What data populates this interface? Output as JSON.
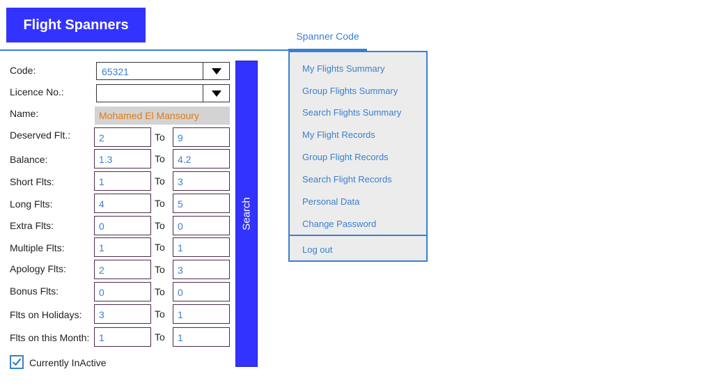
{
  "app": {
    "title": "Flight Spanners"
  },
  "menu": {
    "tab_label": "Spanner Code",
    "items": [
      "My Flights Summary",
      "Group Flights Summary",
      "Search Flights Summary",
      "My Flight Records",
      "Group Flight Records",
      "Search Flight Records",
      "Personal Data",
      "Change Password"
    ],
    "logout": "Log out"
  },
  "form": {
    "code": {
      "label": "Code:",
      "value": "65321"
    },
    "licence": {
      "label": "Licence No.:",
      "value": ""
    },
    "name": {
      "label": "Name:",
      "value": "Mohamed El Mansoury"
    },
    "to_label": "To",
    "ranges": [
      {
        "label": "Deserved Flt.:",
        "from": "2",
        "to": "9"
      },
      {
        "label": "Balance:",
        "from": "1.3",
        "to": "4.2"
      },
      {
        "label": "Short Flts:",
        "from": "1",
        "to": "3"
      },
      {
        "label": "Long Flts:",
        "from": "4",
        "to": "5"
      },
      {
        "label": "Extra Flts:",
        "from": "0",
        "to": "0"
      },
      {
        "label": "Multiple Flts:",
        "from": "1",
        "to": "1"
      },
      {
        "label": "Apology Flts:",
        "from": "2",
        "to": "3"
      },
      {
        "label": "Bonus Flts:",
        "from": "0",
        "to": "0"
      },
      {
        "label": "Flts on Holidays:",
        "from": "3",
        "to": "1"
      },
      {
        "label": "Flts on this Month:",
        "from": "1",
        "to": "1"
      }
    ],
    "inactive": {
      "label": "Currently InActive",
      "checked": true
    },
    "search_label": "Search"
  },
  "colors": {
    "brand": "#3333ff",
    "accent": "#3a7fcf",
    "name_text": "#e07a10"
  },
  "icons": {
    "dropdown": "chevron-down-icon",
    "check": "checkmark-icon"
  }
}
